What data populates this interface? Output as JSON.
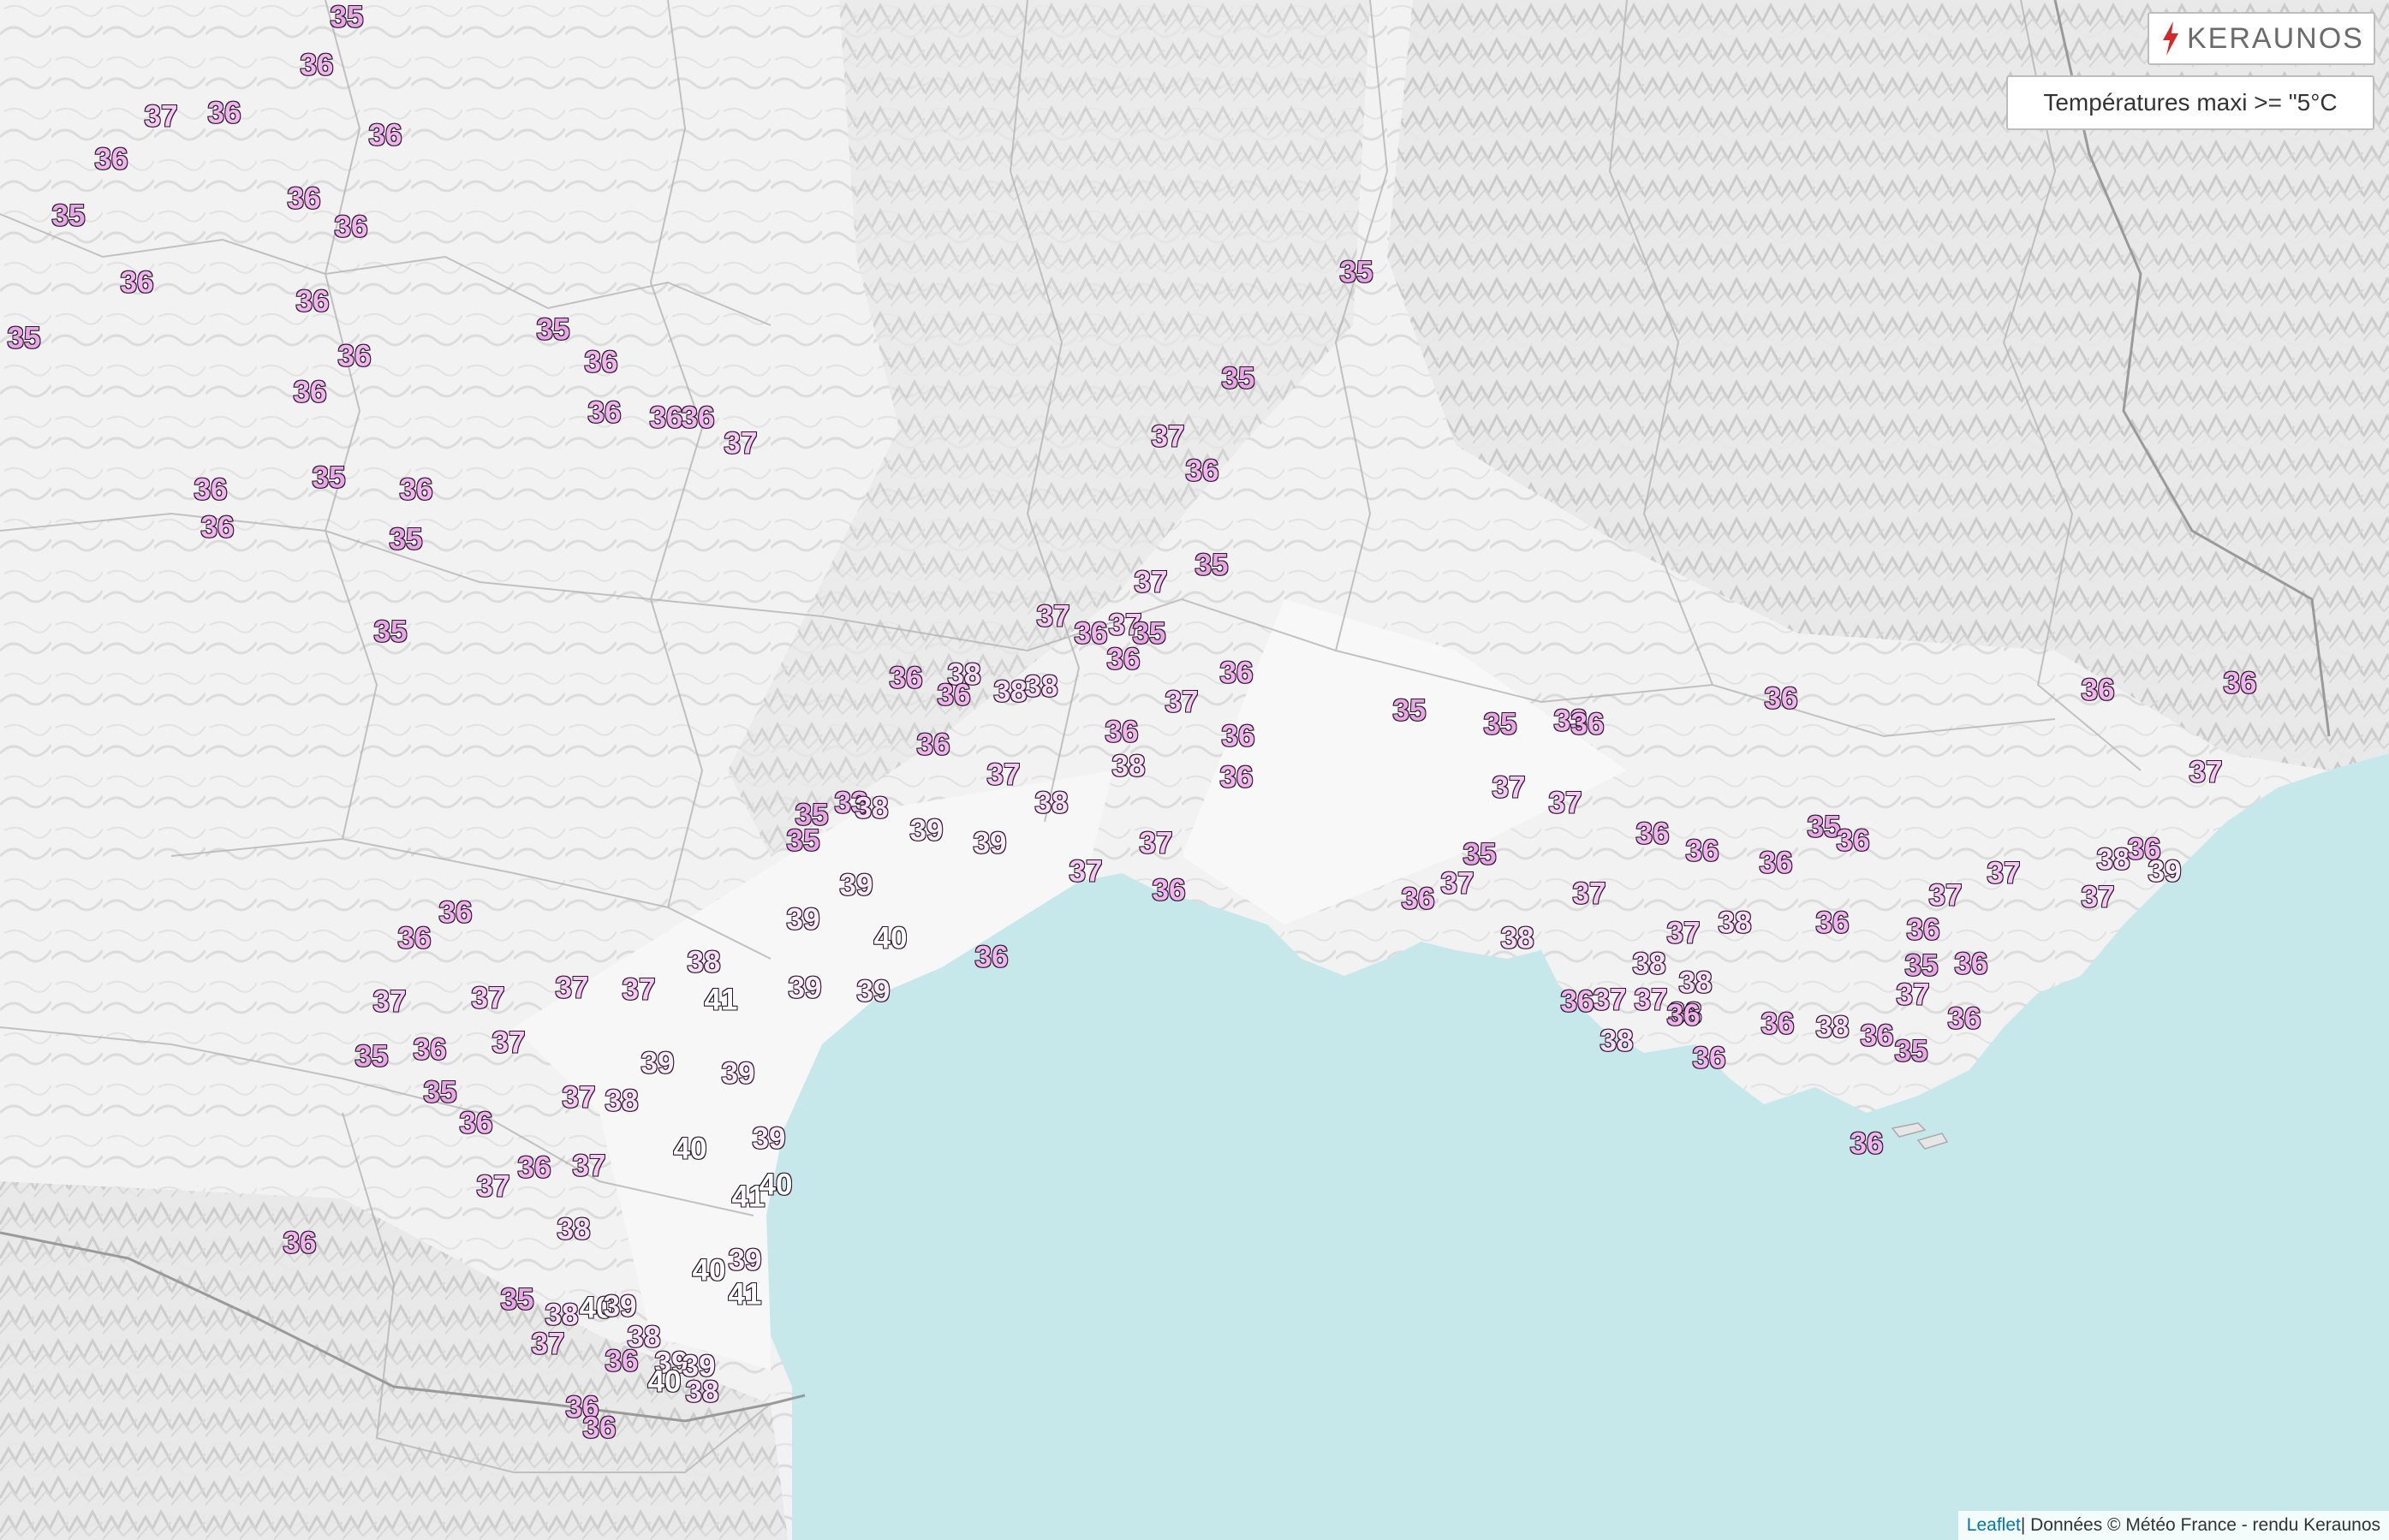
{
  "legend": {
    "title": "Températures maxi >= \"5°C"
  },
  "logo": {
    "text": "KERAUNOS"
  },
  "attribution": {
    "link_text": "Leaflet",
    "text": " | Données © Météo France - rendu Keraunos"
  },
  "colors": {
    "sea": "#c6e8ea",
    "land": "#f3f3f3",
    "t35": "#e9a6e6",
    "t36": "#f2b4ee",
    "t37": "#f6c8f3",
    "t38": "#f9dcf7",
    "t39": "#fbeafa",
    "t40": "#ffffff",
    "t41": "#ffffff",
    "brand_red": "#d22a2a"
  },
  "stations": [
    {
      "v": "35"
    },
    {
      "v": "36"
    },
    {
      "v": "37"
    },
    {
      "v": "36"
    },
    {
      "v": "36"
    },
    {
      "v": "36"
    },
    {
      "v": "36"
    },
    {
      "v": "36"
    },
    {
      "v": "35"
    },
    {
      "v": "36"
    },
    {
      "v": "35"
    },
    {
      "v": "36"
    },
    {
      "v": "36"
    },
    {
      "v": "36"
    },
    {
      "v": "35"
    },
    {
      "v": "36"
    },
    {
      "v": "36"
    },
    {
      "v": "36"
    },
    {
      "v": "36"
    },
    {
      "v": "37"
    },
    {
      "v": "36"
    },
    {
      "v": "35"
    },
    {
      "v": "36"
    },
    {
      "v": "36"
    },
    {
      "v": "35"
    },
    {
      "v": "35"
    },
    {
      "v": "35"
    },
    {
      "v": "35"
    },
    {
      "v": "37"
    },
    {
      "v": "36"
    },
    {
      "v": "35"
    },
    {
      "v": "37"
    },
    {
      "v": "37"
    },
    {
      "v": "36"
    },
    {
      "v": "37"
    },
    {
      "v": "35"
    },
    {
      "v": "36"
    },
    {
      "v": "36"
    },
    {
      "v": "38"
    },
    {
      "v": "36"
    },
    {
      "v": "38"
    },
    {
      "v": "38"
    },
    {
      "v": "37"
    },
    {
      "v": "36"
    },
    {
      "v": "36"
    },
    {
      "v": "36"
    },
    {
      "v": "38"
    },
    {
      "v": "36"
    },
    {
      "v": "36"
    },
    {
      "v": "37"
    },
    {
      "v": "38"
    },
    {
      "v": "35"
    },
    {
      "v": "33"
    },
    {
      "v": "38"
    },
    {
      "v": "35"
    },
    {
      "v": "39"
    },
    {
      "v": "39"
    },
    {
      "v": "37"
    },
    {
      "v": "37"
    },
    {
      "v": "36"
    },
    {
      "v": "39"
    },
    {
      "v": "39"
    },
    {
      "v": "40"
    },
    {
      "v": "36"
    },
    {
      "v": "36"
    },
    {
      "v": "36"
    },
    {
      "v": "37"
    },
    {
      "v": "37"
    },
    {
      "v": "37"
    },
    {
      "v": "37"
    },
    {
      "v": "38"
    },
    {
      "v": "41"
    },
    {
      "v": "39"
    },
    {
      "v": "39"
    },
    {
      "v": "35"
    },
    {
      "v": "36"
    },
    {
      "v": "37"
    },
    {
      "v": "39"
    },
    {
      "v": "39"
    },
    {
      "v": "35"
    },
    {
      "v": "36"
    },
    {
      "v": "37"
    },
    {
      "v": "38"
    },
    {
      "v": "40"
    },
    {
      "v": "39"
    },
    {
      "v": "37"
    },
    {
      "v": "36"
    },
    {
      "v": "37"
    },
    {
      "v": "41"
    },
    {
      "v": "40"
    },
    {
      "v": "36"
    },
    {
      "v": "38"
    },
    {
      "v": "40"
    },
    {
      "v": "39"
    },
    {
      "v": "41"
    },
    {
      "v": "35"
    },
    {
      "v": "38"
    },
    {
      "v": "40"
    },
    {
      "v": "39"
    },
    {
      "v": "37"
    },
    {
      "v": "38"
    },
    {
      "v": "36"
    },
    {
      "v": "39"
    },
    {
      "v": "39"
    },
    {
      "v": "40"
    },
    {
      "v": "38"
    },
    {
      "v": "36"
    },
    {
      "v": "36"
    },
    {
      "v": "35"
    },
    {
      "v": "35"
    },
    {
      "v": "33"
    },
    {
      "v": "36"
    },
    {
      "v": "36"
    },
    {
      "v": "36"
    },
    {
      "v": "36"
    },
    {
      "v": "37"
    },
    {
      "v": "37"
    },
    {
      "v": "37"
    },
    {
      "v": "35"
    },
    {
      "v": "37"
    },
    {
      "v": "36"
    },
    {
      "v": "38"
    },
    {
      "v": "37"
    },
    {
      "v": "35"
    },
    {
      "v": "36"
    },
    {
      "v": "36"
    },
    {
      "v": "36"
    },
    {
      "v": "36"
    },
    {
      "v": "37"
    },
    {
      "v": "37"
    },
    {
      "v": "38"
    },
    {
      "v": "36"
    },
    {
      "v": "39"
    },
    {
      "v": "37"
    },
    {
      "v": "36"
    },
    {
      "v": "38"
    },
    {
      "v": "37"
    },
    {
      "v": "36"
    },
    {
      "v": "38"
    },
    {
      "v": "38"
    },
    {
      "v": "36"
    },
    {
      "v": "36"
    },
    {
      "v": "37"
    },
    {
      "v": "37"
    },
    {
      "v": "38"
    },
    {
      "v": "35"
    },
    {
      "v": "37"
    },
    {
      "v": "38"
    },
    {
      "v": "36"
    },
    {
      "v": "36"
    },
    {
      "v": "38"
    },
    {
      "v": "36"
    },
    {
      "v": "36"
    },
    {
      "v": "35"
    },
    {
      "v": "36"
    },
    {
      "v": "36"
    }
  ]
}
